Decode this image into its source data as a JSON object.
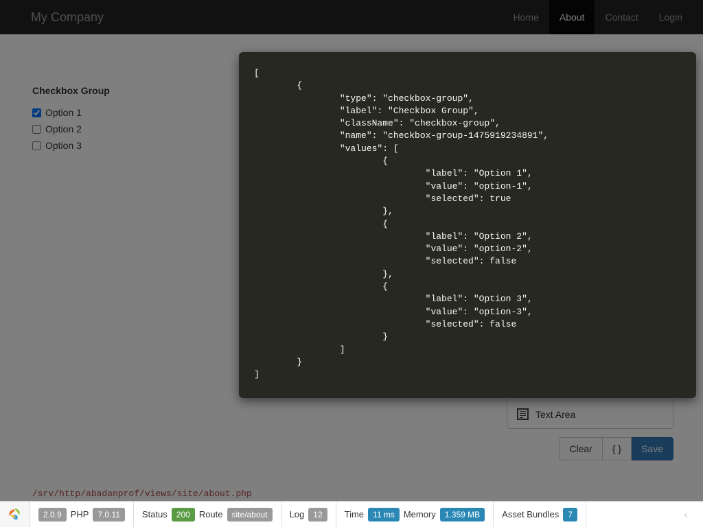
{
  "navbar": {
    "brand": "My Company",
    "links": [
      {
        "label": "Home",
        "active": false
      },
      {
        "label": "About",
        "active": true
      },
      {
        "label": "Contact",
        "active": false
      },
      {
        "label": "Login",
        "active": false
      }
    ]
  },
  "form": {
    "group_label": "Checkbox Group",
    "options": [
      {
        "label": "Option 1",
        "checked": true
      },
      {
        "label": "Option 2",
        "checked": false
      },
      {
        "label": "Option 3",
        "checked": false
      }
    ]
  },
  "builder": {
    "item_label": "Text Area",
    "buttons": {
      "clear": "Clear",
      "json": "{ }",
      "save": "Save"
    },
    "save_color": "#337ab7"
  },
  "file_path": "/srv/http/abadanprof/views/site/about.php",
  "modal": {
    "json_text": "[\n        {\n                \"type\": \"checkbox-group\",\n                \"label\": \"Checkbox Group\",\n                \"className\": \"checkbox-group\",\n                \"name\": \"checkbox-group-1475919234891\",\n                \"values\": [\n                        {\n                                \"label\": \"Option 1\",\n                                \"value\": \"option-1\",\n                                \"selected\": true\n                        },\n                        {\n                                \"label\": \"Option 2\",\n                                \"value\": \"option-2\",\n                                \"selected\": false\n                        },\n                        {\n                                \"label\": \"Option 3\",\n                                \"value\": \"option-3\",\n                                \"selected\": false\n                        }\n                ]\n        }\n]",
    "background": "#272822"
  },
  "debugbar": {
    "version": "2.0.9",
    "php_label": "PHP",
    "php_version": "7.0.11",
    "status_label": "Status",
    "status_code": "200",
    "route_label": "Route",
    "route_value": "site/about",
    "log_label": "Log",
    "log_count": "12",
    "time_label": "Time",
    "time_value": "11 ms",
    "memory_label": "Memory",
    "memory_value": "1.359 MB",
    "asset_label": "Asset Bundles",
    "asset_count": "7",
    "collapse_icon": "‹",
    "status_color": "#5b9b43",
    "accent_color": "#2b88b5"
  }
}
